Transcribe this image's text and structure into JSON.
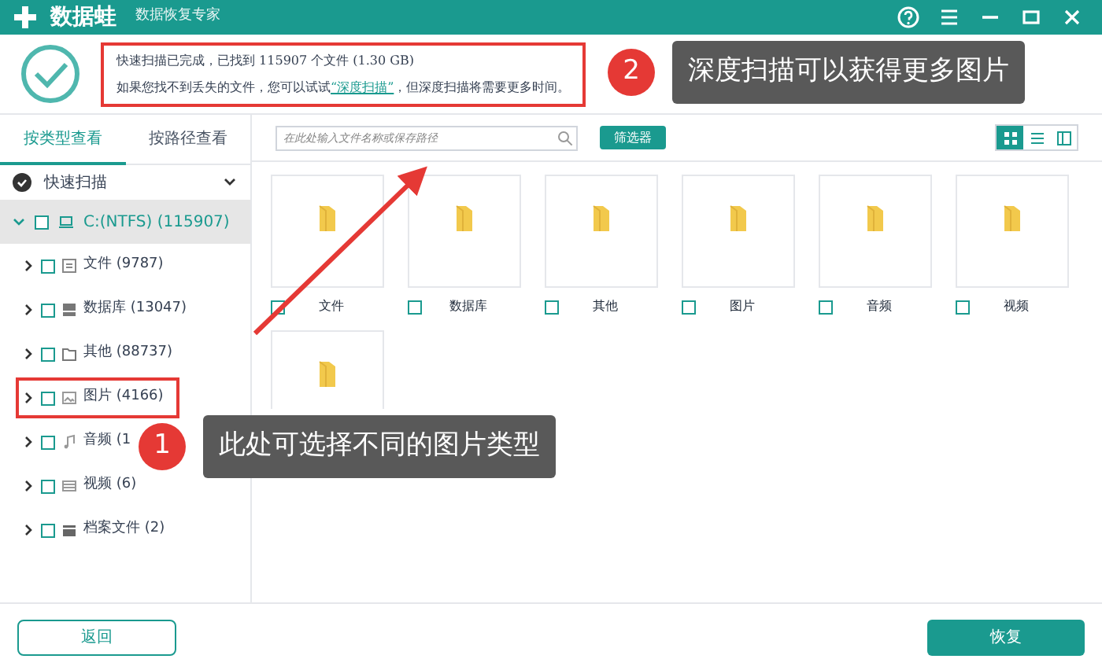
{
  "window": {
    "app_name": "数据蛙",
    "subtitle": "数据恢复专家"
  },
  "scan_summary": {
    "line_1": "快速扫描已完成，已找到 115907 个文件 (1.30 GB)",
    "line_2_before": "如果您找不到丢失的文件，您可以试试",
    "deep_scan_link": "“深度扫描”",
    "line_2_after": "，但深度扫描将需要更多时间。"
  },
  "tabs": [
    {
      "label": "按类型查看",
      "selected": true
    },
    {
      "label": "按路径查看",
      "selected": false
    }
  ],
  "scan_mode": {
    "label": "快速扫描",
    "expanded": true
  },
  "tree": [
    {
      "label": "C:(NTFS) (115907)",
      "selected": true,
      "expanded": true,
      "checked": false,
      "children": [
        {
          "label": "文件 (9787)",
          "kind": "file",
          "checked": false
        },
        {
          "label": "数据库 (13047)",
          "kind": "database",
          "checked": false
        },
        {
          "label": "其他 (88737)",
          "kind": "folder",
          "checked": false
        },
        {
          "label": "图片 (4166)",
          "kind": "image",
          "checked": false
        },
        {
          "label": "音频 (1",
          "kind": "audio",
          "checked": false
        },
        {
          "label": "视频 (6)",
          "kind": "video",
          "checked": false
        },
        {
          "label": "档案文件 (2)",
          "kind": "archive",
          "checked": false
        }
      ]
    }
  ],
  "search": {
    "placeholder": "在此处输入文件名称或保存路径"
  },
  "filter_button": "筛选器",
  "view_modes": [
    {
      "kind": "grid",
      "selected": true
    },
    {
      "kind": "list",
      "selected": false
    },
    {
      "kind": "detail",
      "selected": false
    }
  ],
  "folders": [
    {
      "label": "文件",
      "checked": false
    },
    {
      "label": "数据库",
      "checked": false
    },
    {
      "label": "其他",
      "checked": false
    },
    {
      "label": "图片",
      "checked": false
    },
    {
      "label": "音频",
      "checked": false
    },
    {
      "label": "视频",
      "checked": false
    }
  ],
  "annotations": [
    {
      "number": "2",
      "text": "深度扫描可以获得更多图片"
    },
    {
      "number": "1",
      "text": "此处可选择不同的图片类型"
    }
  ],
  "footer": {
    "back_button": "返回",
    "recover_button": "恢复"
  }
}
